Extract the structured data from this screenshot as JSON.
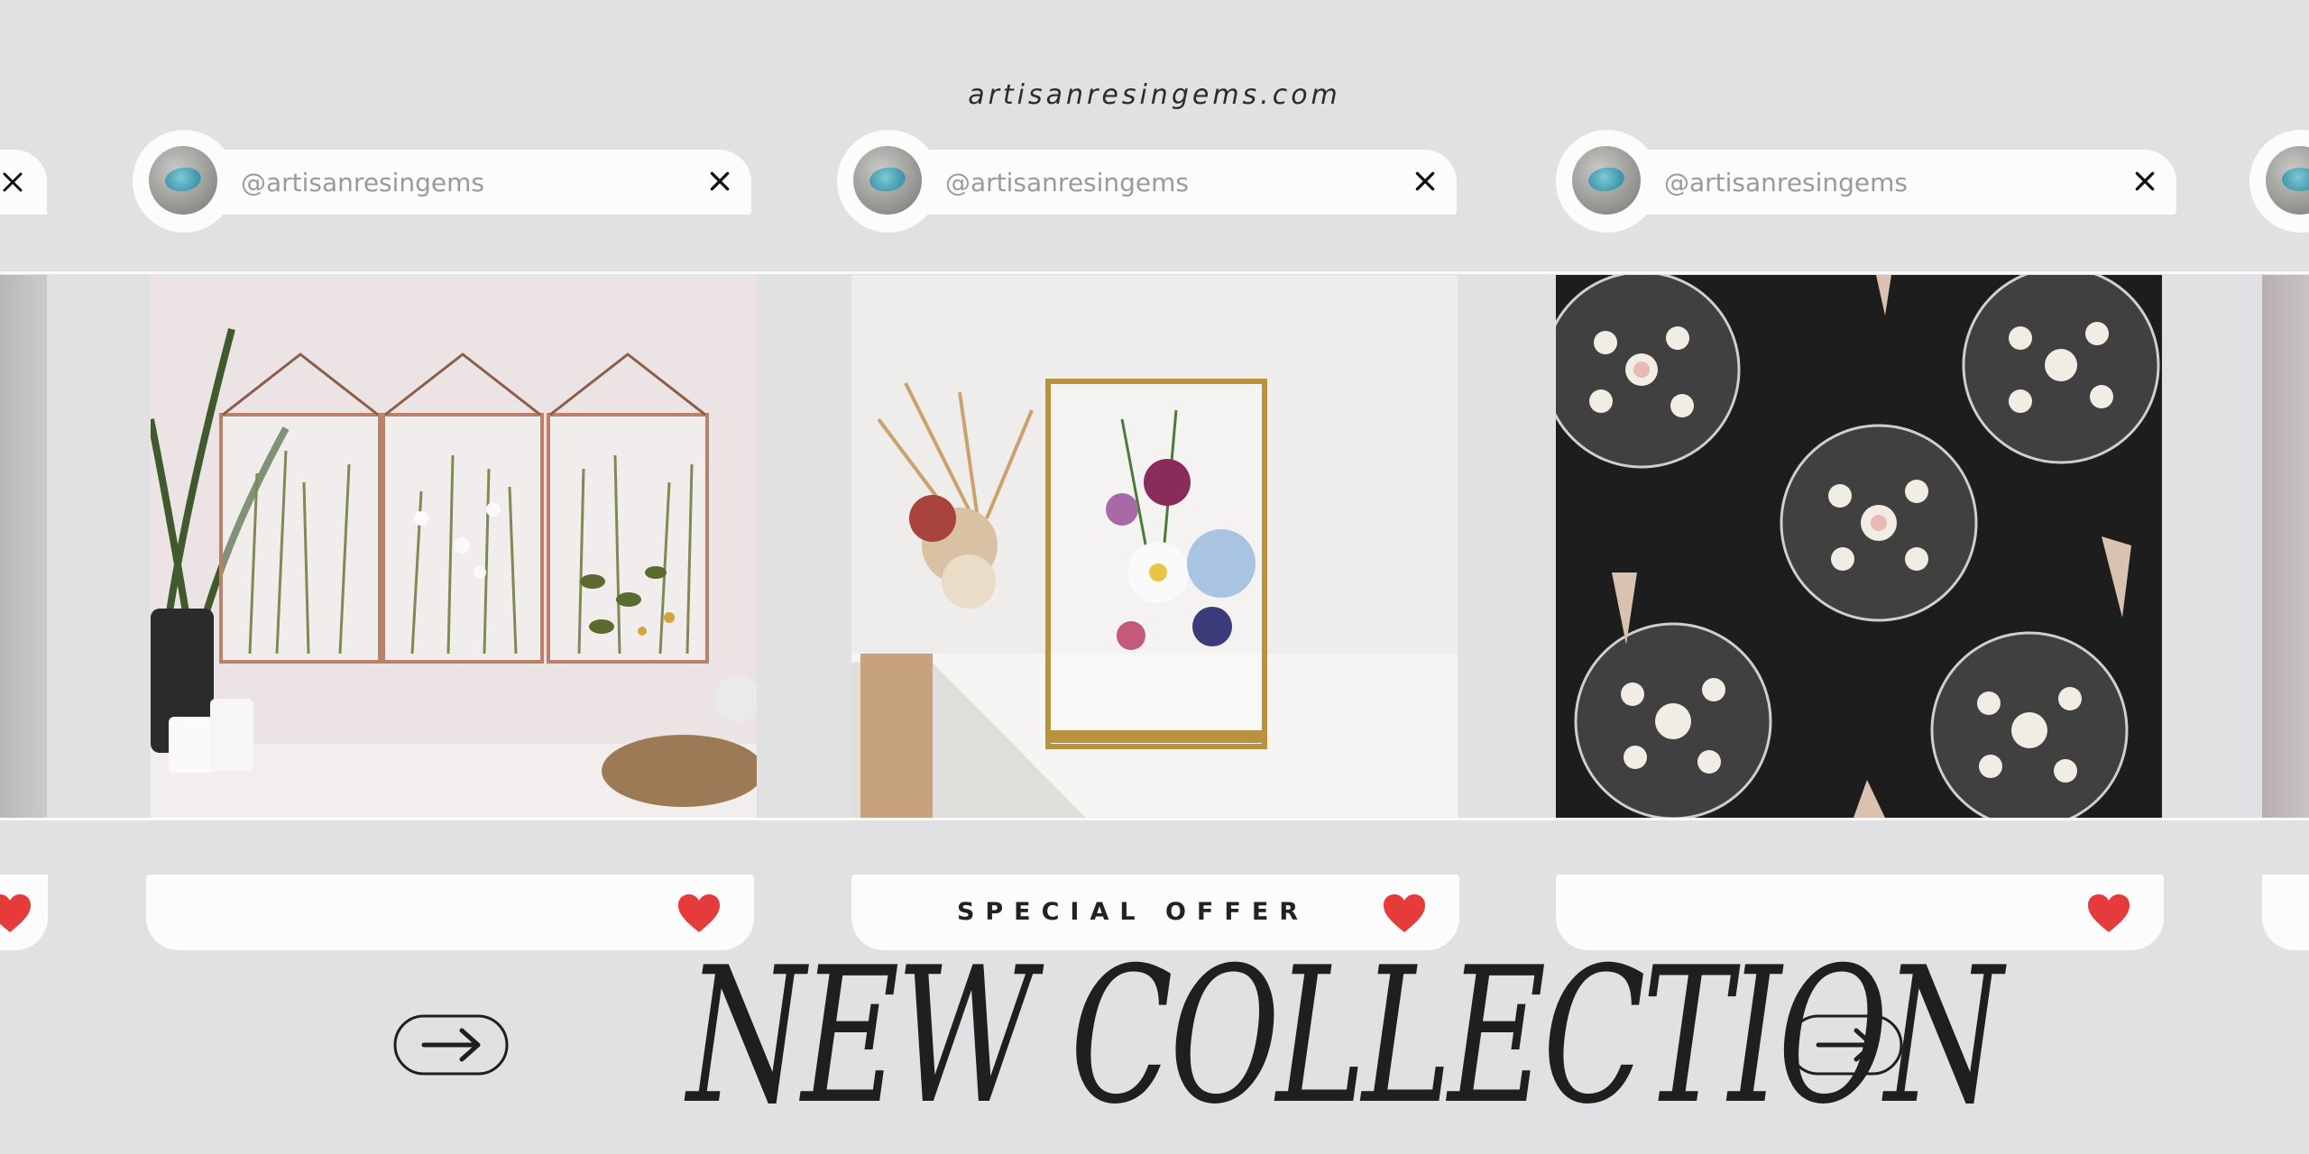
{
  "site": {
    "url": "artisanresingems.com"
  },
  "profiles": [
    {
      "handle": "@artisanresingems"
    },
    {
      "handle": "@artisanresingems"
    },
    {
      "handle": "@artisanresingems"
    }
  ],
  "cards": [
    {
      "label": ""
    },
    {
      "label": "SPECIAL OFFER"
    },
    {
      "label": ""
    }
  ],
  "headline": {
    "text": "NEW COLLECTION"
  },
  "colors": {
    "background": "#e1e1e3",
    "heart": "#e53b3a",
    "text": "#1f1f1f"
  },
  "icons": [
    "close-icon",
    "heart-icon",
    "arrow-right-icon"
  ]
}
